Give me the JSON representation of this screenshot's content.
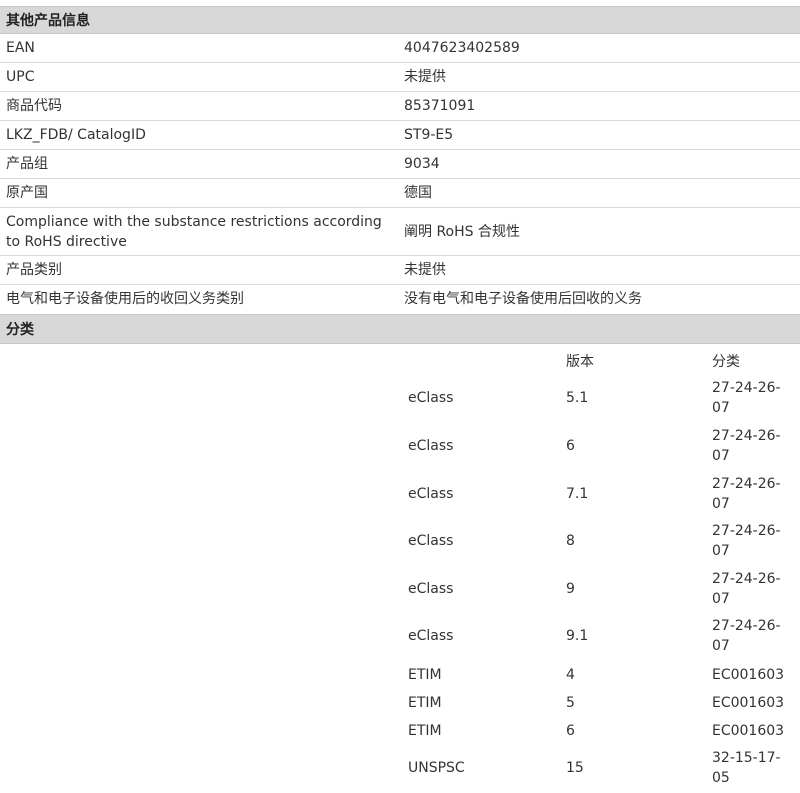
{
  "other_info": {
    "title": "其他产品信息",
    "rows": [
      {
        "label": "EAN",
        "value": "4047623402589"
      },
      {
        "label": "UPC",
        "value": "未提供"
      },
      {
        "label": "商品代码",
        "value": "85371091"
      },
      {
        "label": "LKZ_FDB/ CatalogID",
        "value": "ST9-E5"
      },
      {
        "label": "产品组",
        "value": "9034"
      },
      {
        "label": "原产国",
        "value": "德国"
      },
      {
        "label": "Compliance with the substance restrictions according to RoHS directive",
        "value": "阐明 RoHS 合规性"
      },
      {
        "label": "产品类别",
        "value": "未提供"
      },
      {
        "label": "电气和电子设备使用后的收回义务类别",
        "value": "没有电气和电子设备使用后回收的义务"
      }
    ]
  },
  "classification": {
    "title": "分类",
    "headers": {
      "version": "版本",
      "class": "分类"
    },
    "rows": [
      {
        "system": "eClass",
        "version": "5.1",
        "class": "27-24-26-07"
      },
      {
        "system": "eClass",
        "version": "6",
        "class": "27-24-26-07"
      },
      {
        "system": "eClass",
        "version": "7.1",
        "class": "27-24-26-07"
      },
      {
        "system": "eClass",
        "version": "8",
        "class": "27-24-26-07"
      },
      {
        "system": "eClass",
        "version": "9",
        "class": "27-24-26-07"
      },
      {
        "system": "eClass",
        "version": "9.1",
        "class": "27-24-26-07"
      },
      {
        "system": "ETIM",
        "version": "4",
        "class": "EC001603"
      },
      {
        "system": "ETIM",
        "version": "5",
        "class": "EC001603"
      },
      {
        "system": "ETIM",
        "version": "6",
        "class": "EC001603"
      },
      {
        "system": "UNSPSC",
        "version": "15",
        "class": "32-15-17-05"
      }
    ]
  }
}
